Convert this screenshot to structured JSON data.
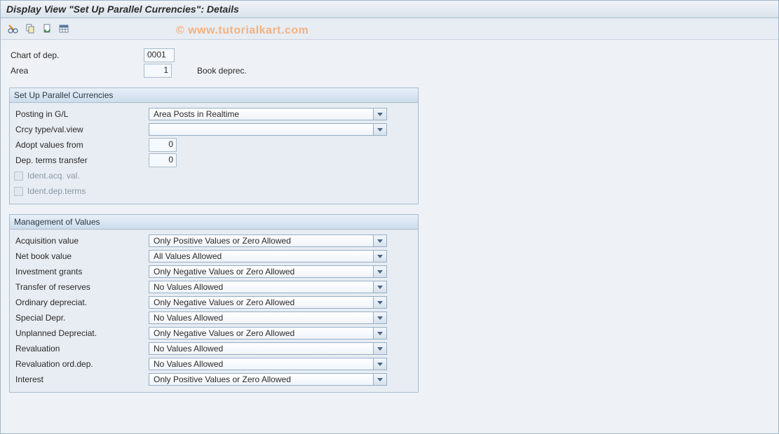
{
  "header": {
    "title": "Display View \"Set Up Parallel Currencies\": Details"
  },
  "watermark": "© www.tutorialkart.com",
  "top": {
    "chart_of_dep": {
      "label": "Chart of dep.",
      "value": "0001"
    },
    "area": {
      "label": "Area",
      "value": "1",
      "description": "Book deprec."
    }
  },
  "group1": {
    "title": "Set Up Parallel Currencies",
    "posting_gl": {
      "label": "Posting in G/L",
      "value": "Area Posts in Realtime"
    },
    "crcy_type": {
      "label": "Crcy type/val.view",
      "value": ""
    },
    "adopt_values": {
      "label": "Adopt values from",
      "value": "0"
    },
    "dep_terms_transfer": {
      "label": "Dep. terms transfer",
      "value": "0"
    },
    "ident_acq_val": {
      "label": "Ident.acq. val.",
      "checked": false,
      "enabled": false
    },
    "ident_dep_terms": {
      "label": "Ident.dep.terms",
      "checked": false,
      "enabled": false
    }
  },
  "group2": {
    "title": "Management of Values",
    "rows": [
      {
        "label": "Acquisition value",
        "value": "Only Positive Values or Zero Allowed"
      },
      {
        "label": "Net book value",
        "value": "All Values Allowed"
      },
      {
        "label": "Investment grants",
        "value": "Only Negative Values or Zero Allowed"
      },
      {
        "label": "Transfer of reserves",
        "value": "No Values Allowed"
      },
      {
        "label": "Ordinary depreciat.",
        "value": "Only Negative Values or Zero Allowed"
      },
      {
        "label": "Special Depr.",
        "value": "No Values Allowed"
      },
      {
        "label": "Unplanned Depreciat.",
        "value": "Only Negative Values or Zero Allowed"
      },
      {
        "label": "Revaluation",
        "value": "No Values Allowed"
      },
      {
        "label": "Revaluation ord.dep.",
        "value": "No Values Allowed"
      },
      {
        "label": "Interest",
        "value": "Only Positive Values or Zero Allowed"
      }
    ]
  }
}
